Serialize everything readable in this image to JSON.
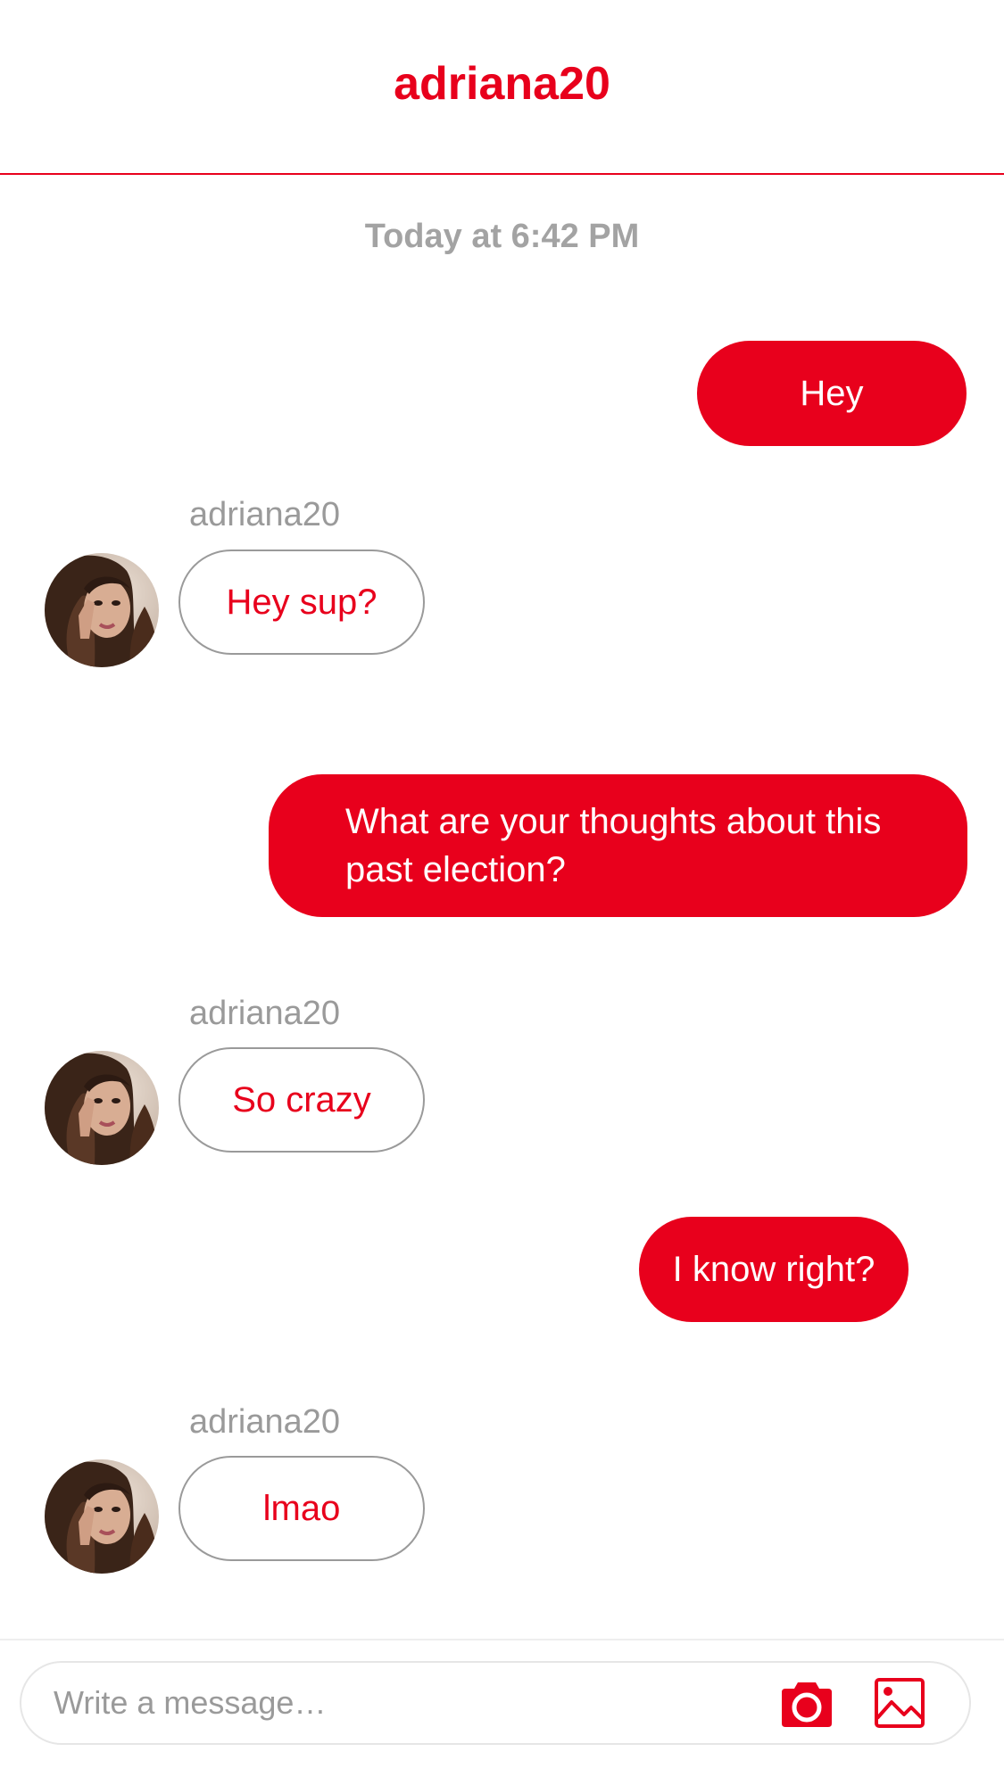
{
  "header": {
    "title": "adriana20"
  },
  "conversation": {
    "timestamp": "Today at 6:42 PM",
    "messages": [
      {
        "direction": "outgoing",
        "text": "Hey"
      },
      {
        "direction": "incoming",
        "sender": "adriana20",
        "text": "Hey sup?"
      },
      {
        "direction": "outgoing",
        "text": "What are your thoughts about this past election?"
      },
      {
        "direction": "incoming",
        "sender": "adriana20",
        "text": "So crazy"
      },
      {
        "direction": "outgoing",
        "text": "I know right?"
      },
      {
        "direction": "incoming",
        "sender": "adriana20",
        "text": "lmao"
      }
    ]
  },
  "composer": {
    "placeholder": "Write a message…",
    "camera_icon": "camera-icon",
    "gallery_icon": "image-gallery-icon"
  },
  "colors": {
    "accent": "#E8001C",
    "muted_text": "#9a9a9a",
    "bubble_border": "#9a9a9a"
  }
}
